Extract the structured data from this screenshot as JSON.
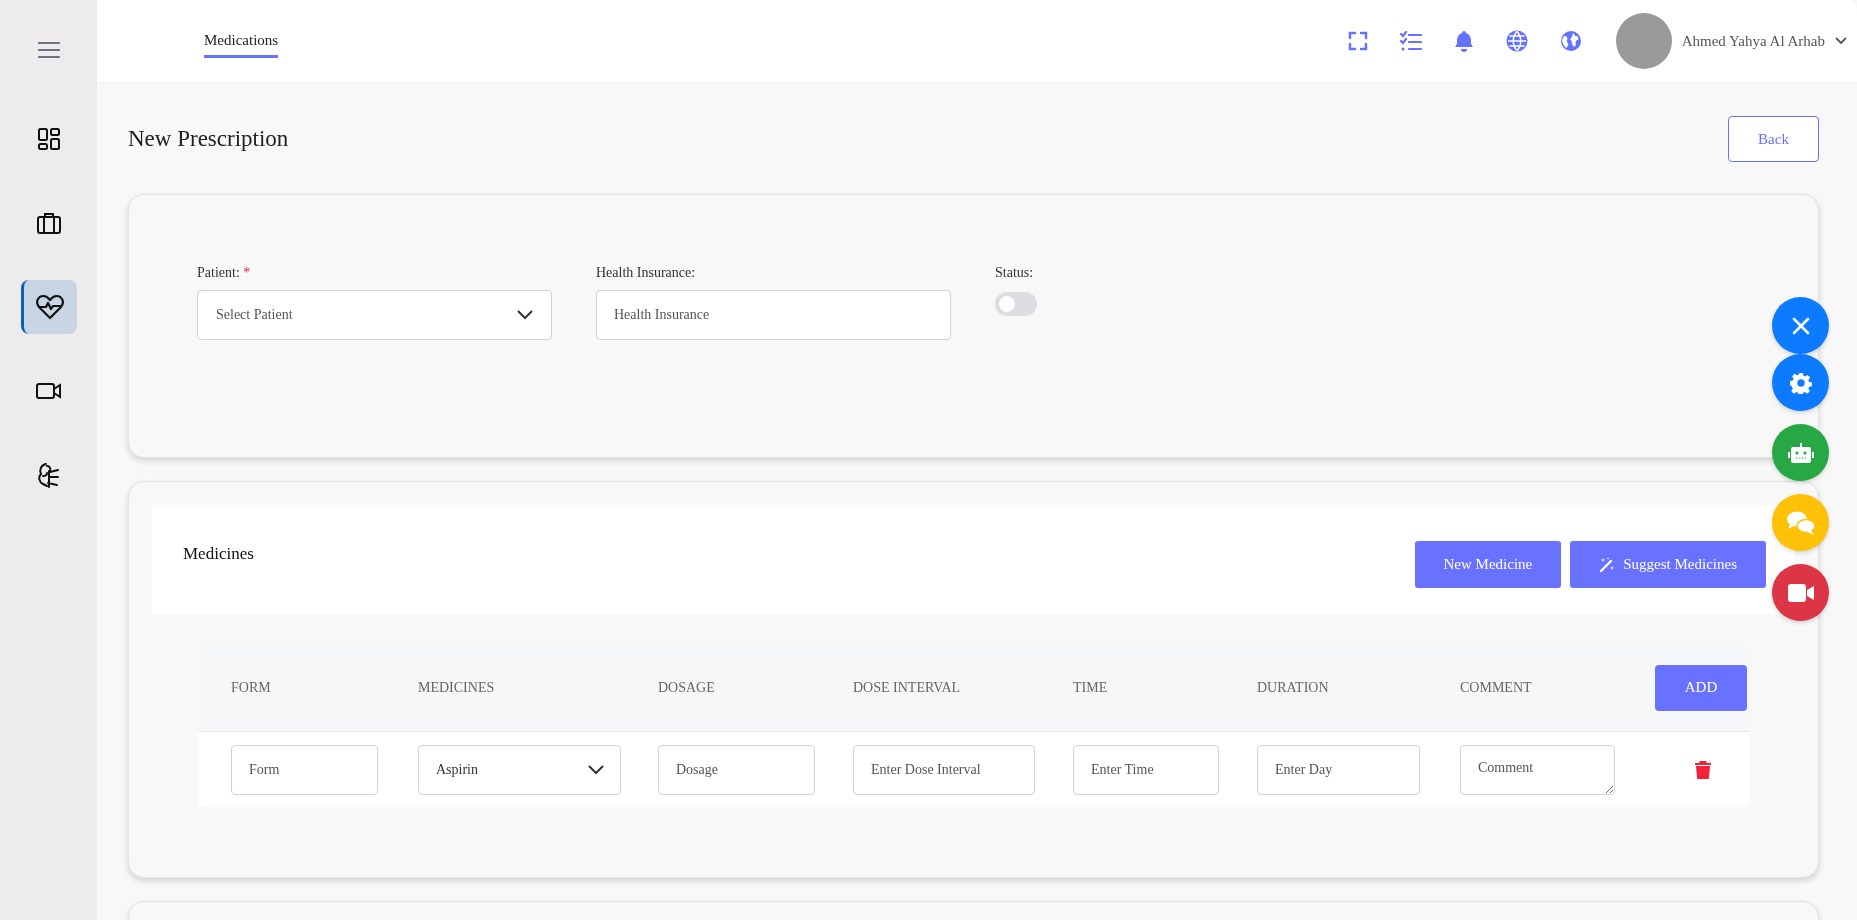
{
  "sidebar": {
    "items": [
      {
        "kind": "dashboard",
        "selected": false
      },
      {
        "kind": "briefcase",
        "selected": false
      },
      {
        "kind": "heart-pulse",
        "selected": true
      },
      {
        "kind": "video",
        "selected": false
      },
      {
        "kind": "person",
        "selected": false
      }
    ]
  },
  "topbar": {
    "tabs": [
      {
        "label": "Medications",
        "selected": true
      }
    ],
    "user_name": "Ahmed Yahya Al Arhab"
  },
  "page": {
    "title": "New Prescription",
    "back_button": "Back"
  },
  "patient_form": {
    "patient": {
      "label": "Patient:",
      "required_mark": "*",
      "placeholder": "Select Patient"
    },
    "health_insurance": {
      "label": "Health Insurance:",
      "placeholder": "Health Insurance"
    },
    "status": {
      "label": "Status:",
      "on": false
    }
  },
  "medicines": {
    "title": "Medicines",
    "buttons": [
      {
        "kind": "plain",
        "label": "New Medicine"
      },
      {
        "kind": "magic",
        "label": "Suggest Medicines"
      }
    ],
    "columns": [
      "FORM",
      "MEDICINES",
      "DOSAGE",
      "DOSE INTERVAL",
      "TIME",
      "DURATION",
      "COMMENT"
    ],
    "add_button": "ADD",
    "rows": [
      {
        "form": {
          "placeholder": "Form"
        },
        "medicine": {
          "value": "Aspirin"
        },
        "dosage": {
          "placeholder": "Dosage"
        },
        "dose_interval": {
          "placeholder": "Enter Dose Interval"
        },
        "time": {
          "placeholder": "Enter Time"
        },
        "duration": {
          "placeholder": "Enter Day"
        },
        "comment": {
          "placeholder": "Comment"
        }
      }
    ]
  },
  "floating_buttons": [
    {
      "kind": "close",
      "color": "#0d7bff"
    },
    {
      "kind": "settings",
      "color": "#0d7bff"
    },
    {
      "kind": "robot",
      "color": "#28a745"
    },
    {
      "kind": "chat",
      "color": "#ffc107"
    },
    {
      "kind": "video",
      "color": "#dc3545"
    }
  ]
}
